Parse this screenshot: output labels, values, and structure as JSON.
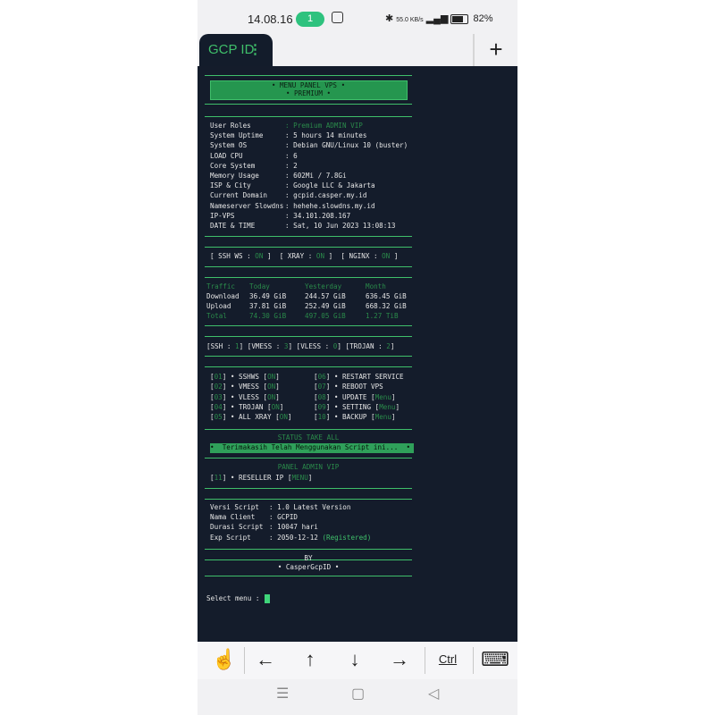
{
  "status_bar": {
    "time": "14.08.16",
    "notification_count": "1",
    "net_speed": "55.0 KB/s",
    "battery": "82%"
  },
  "tabs": {
    "active_tab": "GCP ID",
    "menu_glyph": "⋮",
    "add_glyph": "+"
  },
  "terminal": {
    "header": {
      "title": "• MENU PANEL VPS •",
      "subtitle": "• PREMIUM •"
    },
    "info": [
      {
        "label": "User Roles",
        "value": ": Premium ADMIN VIP"
      },
      {
        "label": "System Uptime",
        "value": ": 5 hours 14 minutes"
      },
      {
        "label": "System OS",
        "value": ": Debian GNU/Linux 10 (buster)"
      },
      {
        "label": "LOAD CPU",
        "value": ": 6"
      },
      {
        "label": "Core System",
        "value": ": 2"
      },
      {
        "label": "Memory Usage",
        "value": ": 602Mi / 7.8Gi"
      },
      {
        "label": "ISP & City",
        "value": ": Google LLC & Jakarta"
      },
      {
        "label": "Current Domain",
        "value": ": gcpid.casper.my.id"
      },
      {
        "label": "Nameserver Slowdns",
        "value": ": hehehe.slowdns.my.id"
      },
      {
        "label": "IP-VPS",
        "value": ": 34.101.208.167"
      },
      {
        "label": "DATE & TIME",
        "value": ": Sat, 10 Jun 2023 13:08:13"
      }
    ],
    "services": [
      {
        "label": "[ SSH WS : ",
        "status": "ON",
        "end": " ]"
      },
      {
        "label": "[ XRAY : ",
        "status": "ON",
        "end": " ]"
      },
      {
        "label": "[ NGINX : ",
        "status": "ON",
        "end": " ]"
      }
    ],
    "traffic": {
      "headers": [
        "Traffic",
        "Today",
        "Yesterday",
        "Month"
      ],
      "rows": [
        {
          "label": "Download",
          "today": "36.49 GiB",
          "yesterday": "244.57 GiB",
          "month": "636.45 GiB"
        },
        {
          "label": "Upload",
          "today": "37.81 GiB",
          "yesterday": "252.49 GiB",
          "month": "668.32 GiB"
        },
        {
          "label": "Total",
          "today": "74.30 GiB",
          "yesterday": "497.05 GiB",
          "month": "1.27 TiB"
        }
      ]
    },
    "accounts": [
      {
        "label": "[SSH : ",
        "count": "1",
        "end": "]"
      },
      {
        "label": "[VMESS : ",
        "count": "3",
        "end": "]"
      },
      {
        "label": "[VLESS : ",
        "count": "0",
        "end": "]"
      },
      {
        "label": "[TROJAN : ",
        "count": "2",
        "end": "]"
      }
    ],
    "menu_left": [
      {
        "num": "01",
        "label": "• SSHWS",
        "tag": "ON"
      },
      {
        "num": "02",
        "label": "• VMESS",
        "tag": "ON"
      },
      {
        "num": "03",
        "label": "• VLESS",
        "tag": "ON"
      },
      {
        "num": "04",
        "label": "• TROJAN",
        "tag": "ON"
      },
      {
        "num": "05",
        "label": "• ALL XRAY",
        "tag": "ON"
      }
    ],
    "menu_right": [
      {
        "num": "06",
        "label": "• RESTART SERVICE",
        "tag": ""
      },
      {
        "num": "07",
        "label": "• REBOOT VPS",
        "tag": ""
      },
      {
        "num": "08",
        "label": "• UPDATE",
        "tag": "Menu"
      },
      {
        "num": "09",
        "label": "• SETTING",
        "tag": "Menu"
      },
      {
        "num": "10",
        "label": "• BACKUP",
        "tag": "Menu"
      }
    ],
    "status_title": "STATUS TAKE ALL",
    "thanks": "•  Terimakasih Telah Menggunakan Script ini...  •",
    "admin_title": "PANEL ADMIN VIP",
    "admin_item": {
      "num": "11",
      "label": "• RESELLER IP",
      "tag": "MENU"
    },
    "script_info": [
      {
        "label": "Versi Script",
        "value": ": 1.0 Latest Version"
      },
      {
        "label": "Nama Client",
        "value": ": GCPID"
      },
      {
        "label": "Durasi Script",
        "value": ": 10047 hari"
      },
      {
        "label": "Exp Script",
        "value": ": 2050-12-12 ",
        "extra": "(Registered)"
      }
    ],
    "by_label": "BY",
    "author": "• CasperGcpID •",
    "prompt": "Select menu : "
  },
  "keys": {
    "touch": "☝",
    "left": "←",
    "up": "↑",
    "down": "↓",
    "right": "→",
    "ctrl": "Ctrl",
    "keyboard": "⌨"
  },
  "nav": {
    "recent": "☰",
    "home": "▢",
    "back": "◁"
  },
  "colors": {
    "accent": "#3fbf6a",
    "terminal_bg": "#141c2b"
  }
}
